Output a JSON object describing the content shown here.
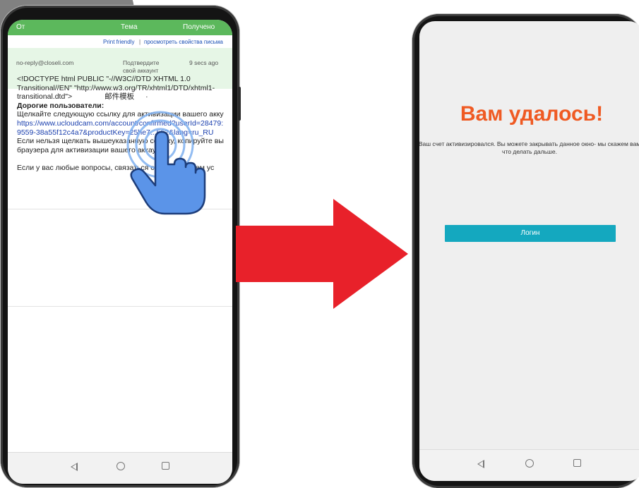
{
  "email": {
    "header": {
      "col_from": "От",
      "col_subject": "Тема",
      "col_received": "Получено"
    },
    "links": {
      "print": "Print friendly",
      "separator": "|",
      "properties": "просмотреть свойства письма"
    },
    "meta": {
      "sender": "no-reply@closeli.com",
      "subject_line1": "Подтвердите",
      "subject_line2": "свой аккаунт",
      "time": "9 secs ago"
    },
    "body": {
      "line1": "<!DOCTYPE html PUBLIC \"-//W3C//DTD XHTML 1.0",
      "line2": "Transitional//EN\" \"http://www.w3.org/TR/xhtml1/DTD/xhtml1-",
      "line3a": "transitional.dtd\">",
      "line3b": "邮件模板",
      "line4": "Дорогие пользователи:",
      "line5": "Щелкайте следующую ссылку для активизации вашего акку",
      "link1": "https://www.ucloudcam.com/account/confirmed?userId=28479:",
      "link2": "9559-38a55f12c4a7&productKey=25he7...562&lang=ru_RU",
      "line6": "Если нельзя щелкать вышеуказанную ссылку, копируйте вы",
      "line7": "браузера для активизации вашего аккаунта",
      "line8": "Если у вас любые вопросы, связаться с отправителем ус"
    }
  },
  "success": {
    "title": "Вам удалось!",
    "message": "Ваш счет активизировался. Вы можете закрывать данное окно- мы скажем вам что делать дальше.",
    "login_button": "Логин"
  },
  "colors": {
    "header_green": "#5cb85c",
    "title_orange": "#ef5a23",
    "button_teal": "#14a8bf",
    "arrow_red": "#e8212a",
    "hand_blue": "#5b94e8"
  },
  "icons": [
    "tap-hand-icon",
    "nav-back-icon",
    "nav-home-icon",
    "nav-recent-icon",
    "arrow-right-icon"
  ]
}
